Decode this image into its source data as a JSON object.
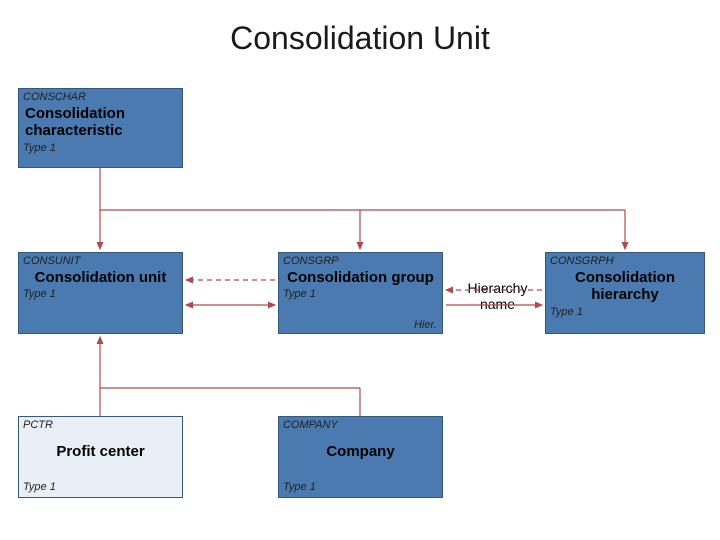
{
  "title": "Consolidation Unit",
  "nodes": {
    "conschar": {
      "code": "CONSCHAR",
      "label": "Consolidation characteristic",
      "type": "Type 1"
    },
    "consunit": {
      "code": "CONSUNIT",
      "label": "Consolidation unit",
      "type": "Type 1"
    },
    "consgrp": {
      "code": "CONSGRP",
      "label": "Consolidation group",
      "type": "Type 1"
    },
    "consgrph": {
      "code": "CONSGRPH",
      "label": "Consolidation hierarchy",
      "type": "Type 1"
    },
    "pctr": {
      "code": "PCTR",
      "label": "Profit center",
      "type": "Type 1"
    },
    "company": {
      "code": "COMPANY",
      "label": "Company",
      "type": "Type 1"
    }
  },
  "annotations": {
    "hierarchy_name": "Hierarchy name",
    "hier": "Hier."
  },
  "colors": {
    "node_blue": "#4a7ab0",
    "node_light": "#e8eff7",
    "arrow": "#b24a4a"
  },
  "edges": [
    {
      "from": "conschar",
      "to": "consunit",
      "style": "solid",
      "dir": "forward"
    },
    {
      "from": "conschar",
      "to": "consgrp",
      "style": "solid",
      "dir": "forward"
    },
    {
      "from": "conschar",
      "to": "consgrph",
      "style": "solid",
      "dir": "forward"
    },
    {
      "from": "consunit",
      "to": "consgrp",
      "style": "solid",
      "dir": "both"
    },
    {
      "from": "consunit",
      "to": "consgrp",
      "style": "dashed",
      "dir": "backward"
    },
    {
      "from": "consgrp",
      "to": "consgrph",
      "style": "solid",
      "dir": "forward",
      "via": "hierarchy_name"
    },
    {
      "from": "consgrp",
      "to": "consgrph",
      "style": "dashed",
      "dir": "backward"
    },
    {
      "from": "pctr",
      "to": "consunit",
      "style": "solid",
      "dir": "forward"
    },
    {
      "from": "company",
      "to": "consunit",
      "style": "solid",
      "dir": "forward"
    }
  ]
}
